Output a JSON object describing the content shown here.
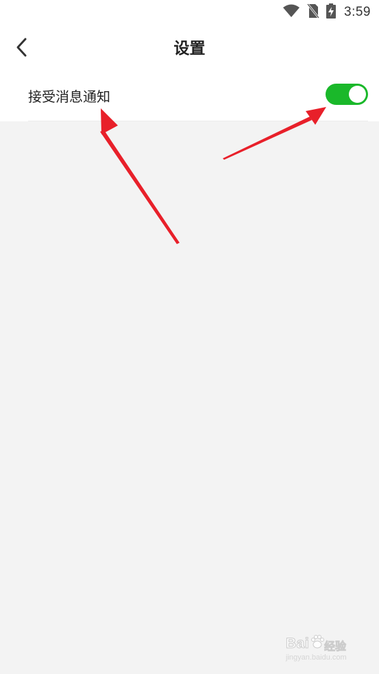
{
  "status_bar": {
    "time": "3:59",
    "icons": [
      "wifi-icon",
      "no-sim-icon",
      "battery-charging-icon"
    ]
  },
  "header": {
    "back_icon": "chevron-left-icon",
    "title": "设置"
  },
  "settings": {
    "items": [
      {
        "label": "接受消息通知",
        "toggle_on": true
      }
    ]
  },
  "colors": {
    "toggle_on": "#1ab82a",
    "background": "#f3f3f3",
    "annotation_arrow": "#e8202a"
  },
  "watermark": {
    "brand": "Bai",
    "cn": "经验",
    "url": "jingyan.baidu.com"
  }
}
